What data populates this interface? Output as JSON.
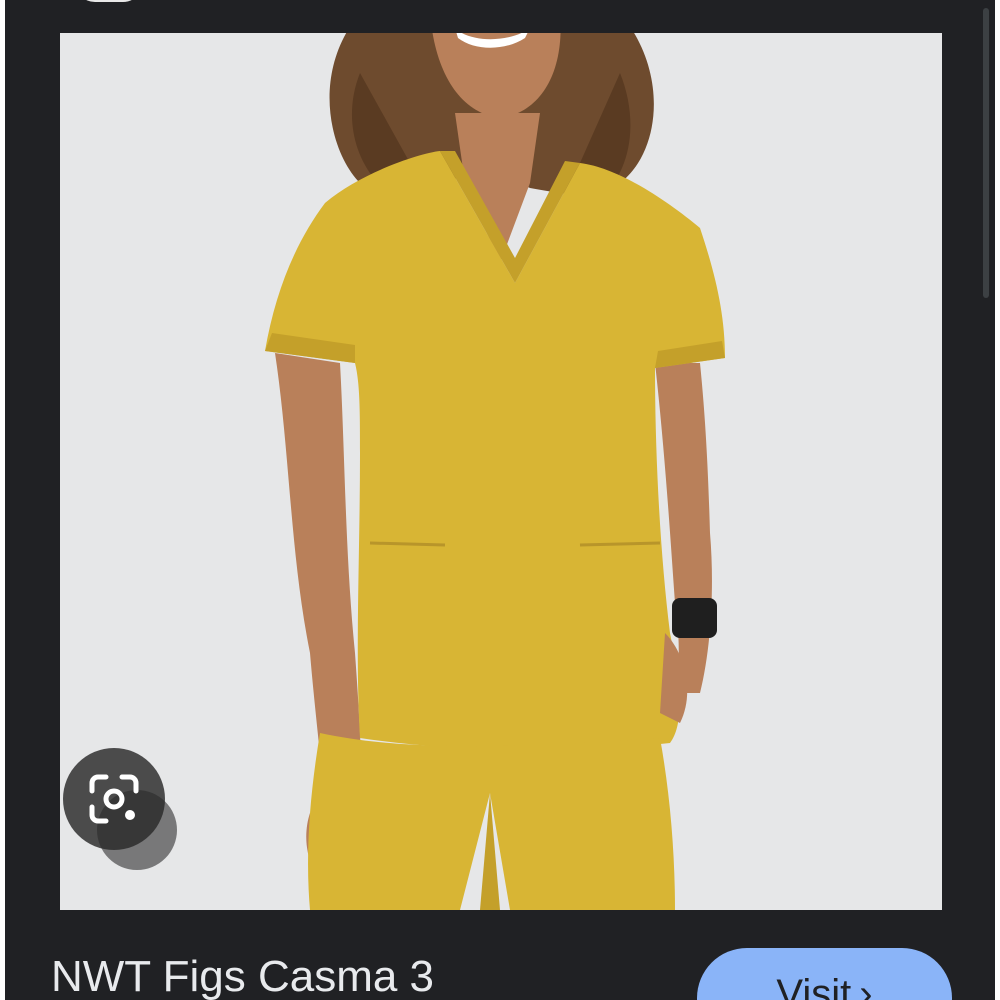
{
  "image": {
    "subject": "",
    "colors": {
      "background": "#e6e7e8",
      "scrubs": "#d8b534",
      "scrubs_shadow": "#c4a02a",
      "skin": "#b9805a",
      "hair": "#6e4b2e"
    }
  },
  "lens": {
    "icon": "google-lens-icon"
  },
  "result": {
    "title": "NWT Figs Casma 3",
    "visit_label": "Visit",
    "visit_icon": "chevron-right-icon"
  },
  "theme": {
    "surface": "#202124",
    "accent": "#8ab4f8",
    "text": "#e8eaed"
  }
}
